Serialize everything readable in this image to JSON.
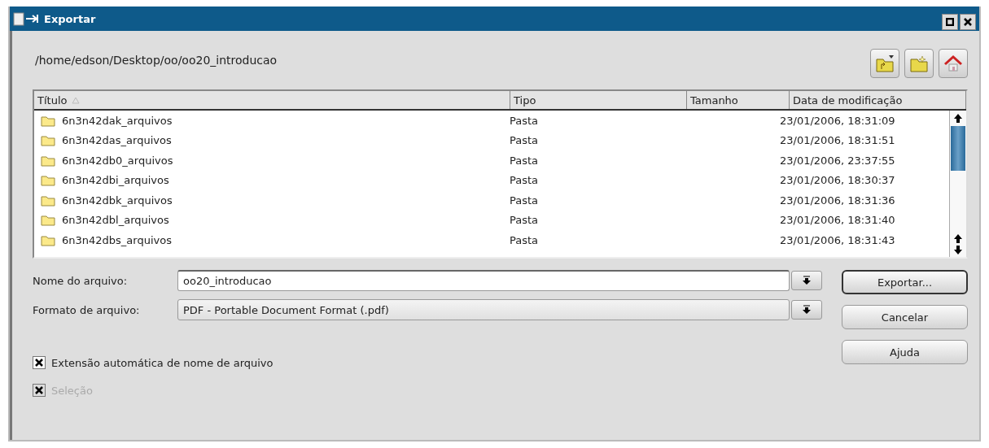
{
  "window": {
    "title": "Exportar"
  },
  "path": "/home/edson/Desktop/oo/oo20_introducao",
  "table": {
    "columns": [
      {
        "label": "Título",
        "sorted": true
      },
      {
        "label": "Tipo",
        "sorted": false
      },
      {
        "label": "Tamanho",
        "sorted": false
      },
      {
        "label": "Data de modificação",
        "sorted": false
      }
    ],
    "rows": [
      {
        "name": "6n3n42dak_arquivos",
        "type": "Pasta",
        "size": "",
        "date": "23/01/2006, 18:31:09"
      },
      {
        "name": "6n3n42das_arquivos",
        "type": "Pasta",
        "size": "",
        "date": "23/01/2006, 18:31:51"
      },
      {
        "name": "6n3n42db0_arquivos",
        "type": "Pasta",
        "size": "",
        "date": "23/01/2006, 23:37:55"
      },
      {
        "name": "6n3n42dbi_arquivos",
        "type": "Pasta",
        "size": "",
        "date": "23/01/2006, 18:30:37"
      },
      {
        "name": "6n3n42dbk_arquivos",
        "type": "Pasta",
        "size": "",
        "date": "23/01/2006, 18:31:36"
      },
      {
        "name": "6n3n42dbl_arquivos",
        "type": "Pasta",
        "size": "",
        "date": "23/01/2006, 18:31:40"
      },
      {
        "name": "6n3n42dbs_arquivos",
        "type": "Pasta",
        "size": "",
        "date": "23/01/2006, 18:31:43"
      }
    ]
  },
  "fields": [
    {
      "label": "Nome do arquivo:",
      "kind": "input",
      "value": "oo20_introducao"
    },
    {
      "label": "Formato de arquivo:",
      "kind": "select",
      "value": "PDF - Portable Document Format (.pdf)"
    }
  ],
  "buttons": [
    {
      "label": "Exportar...",
      "default": true
    },
    {
      "label": "Cancelar",
      "default": false
    },
    {
      "label": "Ajuda",
      "default": false
    }
  ],
  "options": [
    {
      "label": "Extensão automática de nome de arquivo",
      "checked": true,
      "disabled": false
    },
    {
      "label": "Seleção",
      "checked": true,
      "disabled": true
    }
  ]
}
